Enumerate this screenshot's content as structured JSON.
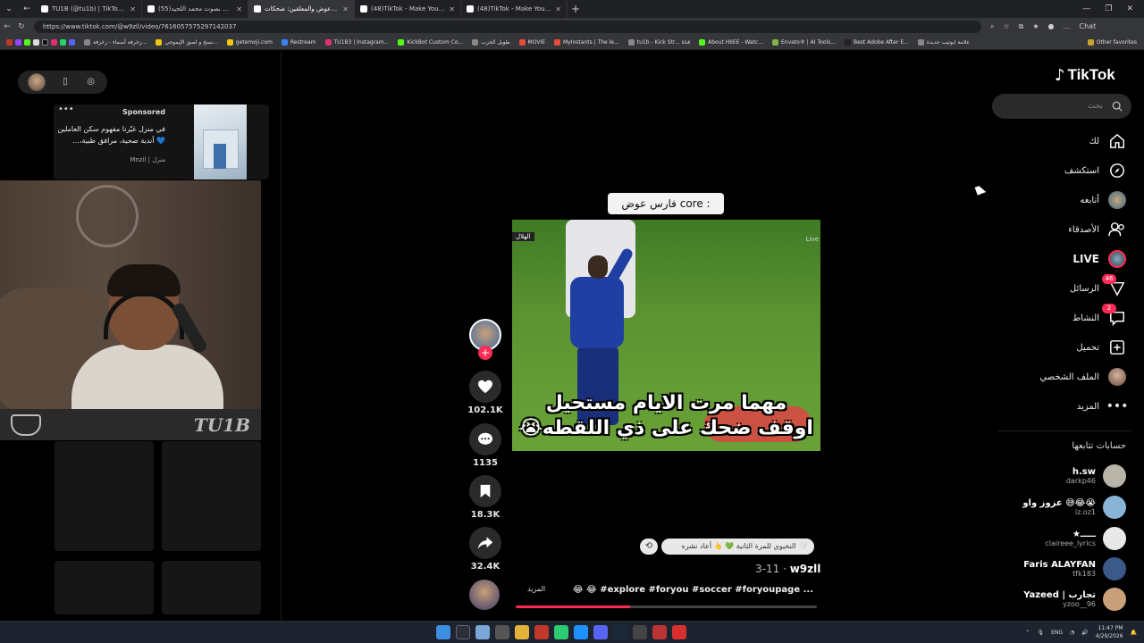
{
  "browser": {
    "tabs": [
      {
        "title": "TU1B (@tu1b) | TikTok(48)",
        "active": false
      },
      {
        "title": "(55)سورة الفرقان بصوت محمد اللحيد",
        "active": false
      },
      {
        "title": "فارس عوض والمعلقين: ضحكات",
        "active": true
      },
      {
        "title": "(48)TikTok - Make Your Day",
        "active": false
      },
      {
        "title": "(48)TikTok - Make Your Day",
        "active": false
      }
    ],
    "url": "https://www.tiktok.com/@w9zll/video/7616057575297142037",
    "bookmarks": [
      "زخرفة أسماء - زخرفة...",
      "نسخ و لصق الإيموجي...",
      "getemoji.com",
      "Restream",
      "TU1B3 | Instagram...",
      "KickBot Custom Co...",
      "طويل الحرب",
      "MOVIE",
      "MyInstants | The le...",
      "tu1b - Kick Str... قناة",
      "About HIIEE - Watc...",
      "Envato® | AI Tools...",
      "Best Adobe After E...",
      "علامة ابوتيب جديدة"
    ],
    "other_bookmarks": "Other favorites",
    "chat_label": "Chat"
  },
  "sponsored": {
    "label": "Sponsored",
    "text": "في منزل غيّرنا مفهوم سكن العاملين 💙 أندية صحية، مرافق طبية،...",
    "brand": "منزل | Mnzil"
  },
  "webcam": {
    "brand": "TU1B"
  },
  "video": {
    "top_label": "فارس عوض core :",
    "channel_tag": "الهلال",
    "live_tag": "Live",
    "caption_line1": "مهما مرت الايام مستحيل",
    "caption_line2": "اوقف ضحك على ذي اللقطه😭",
    "repost_chip": "🤍 النخيوي للمرة الثانية 💚 👆 أعاد نشره",
    "author_user": "w9zll",
    "author_date": "3-11",
    "description": "😂 😂 #explore #foryou #soccer #foryoupage ...",
    "more_label": "المزيد",
    "progress": 0.38
  },
  "actions": {
    "likes": "102.1K",
    "comments": "1135",
    "saves": "18.3K",
    "shares": "32.4K"
  },
  "nav": {
    "logo": "TikTok",
    "search_placeholder": "بحث",
    "items": [
      {
        "label": "لك",
        "icon": "home-icon"
      },
      {
        "label": "استكشف",
        "icon": "compass-icon"
      },
      {
        "label": "أتابعه",
        "icon": "following-avatar-icon"
      },
      {
        "label": "الأصدقاء",
        "icon": "friends-icon"
      },
      {
        "label": "LIVE",
        "icon": "live-avatar-icon"
      },
      {
        "label": "الرسائل",
        "icon": "messages-icon",
        "badge": "46"
      },
      {
        "label": "النشاط",
        "icon": "activity-icon",
        "badge": "2"
      },
      {
        "label": "تحميل",
        "icon": "upload-icon"
      },
      {
        "label": "الملف الشخصي",
        "icon": "profile-avatar-icon"
      },
      {
        "label": "المزيد",
        "icon": "more-icon"
      }
    ],
    "following_title": "حسابات تتابعها",
    "following": [
      {
        "name": "h.sw",
        "handle": "darkp46",
        "color": "#b9b4a8"
      },
      {
        "name": "عزوز واو 😅😂😭",
        "handle": "iz.oz1",
        "color": "#8ab4d6"
      },
      {
        "name": "★ـــــ",
        "handle": "claireee_lyrics",
        "color": "#e8e8e8"
      },
      {
        "name": "Faris ALAYFAN",
        "handle": "tfk183",
        "color": "#3b5a8a"
      },
      {
        "name": "Yazeed | تجارب",
        "handle": "yzoo__96",
        "color": "#c9a07a"
      }
    ]
  },
  "taskbar": {
    "lang": "ENG",
    "time": "11:47 PM",
    "date": "4/29/2026"
  },
  "colors": {
    "accent": "#fe2c55",
    "background": "#000000"
  }
}
